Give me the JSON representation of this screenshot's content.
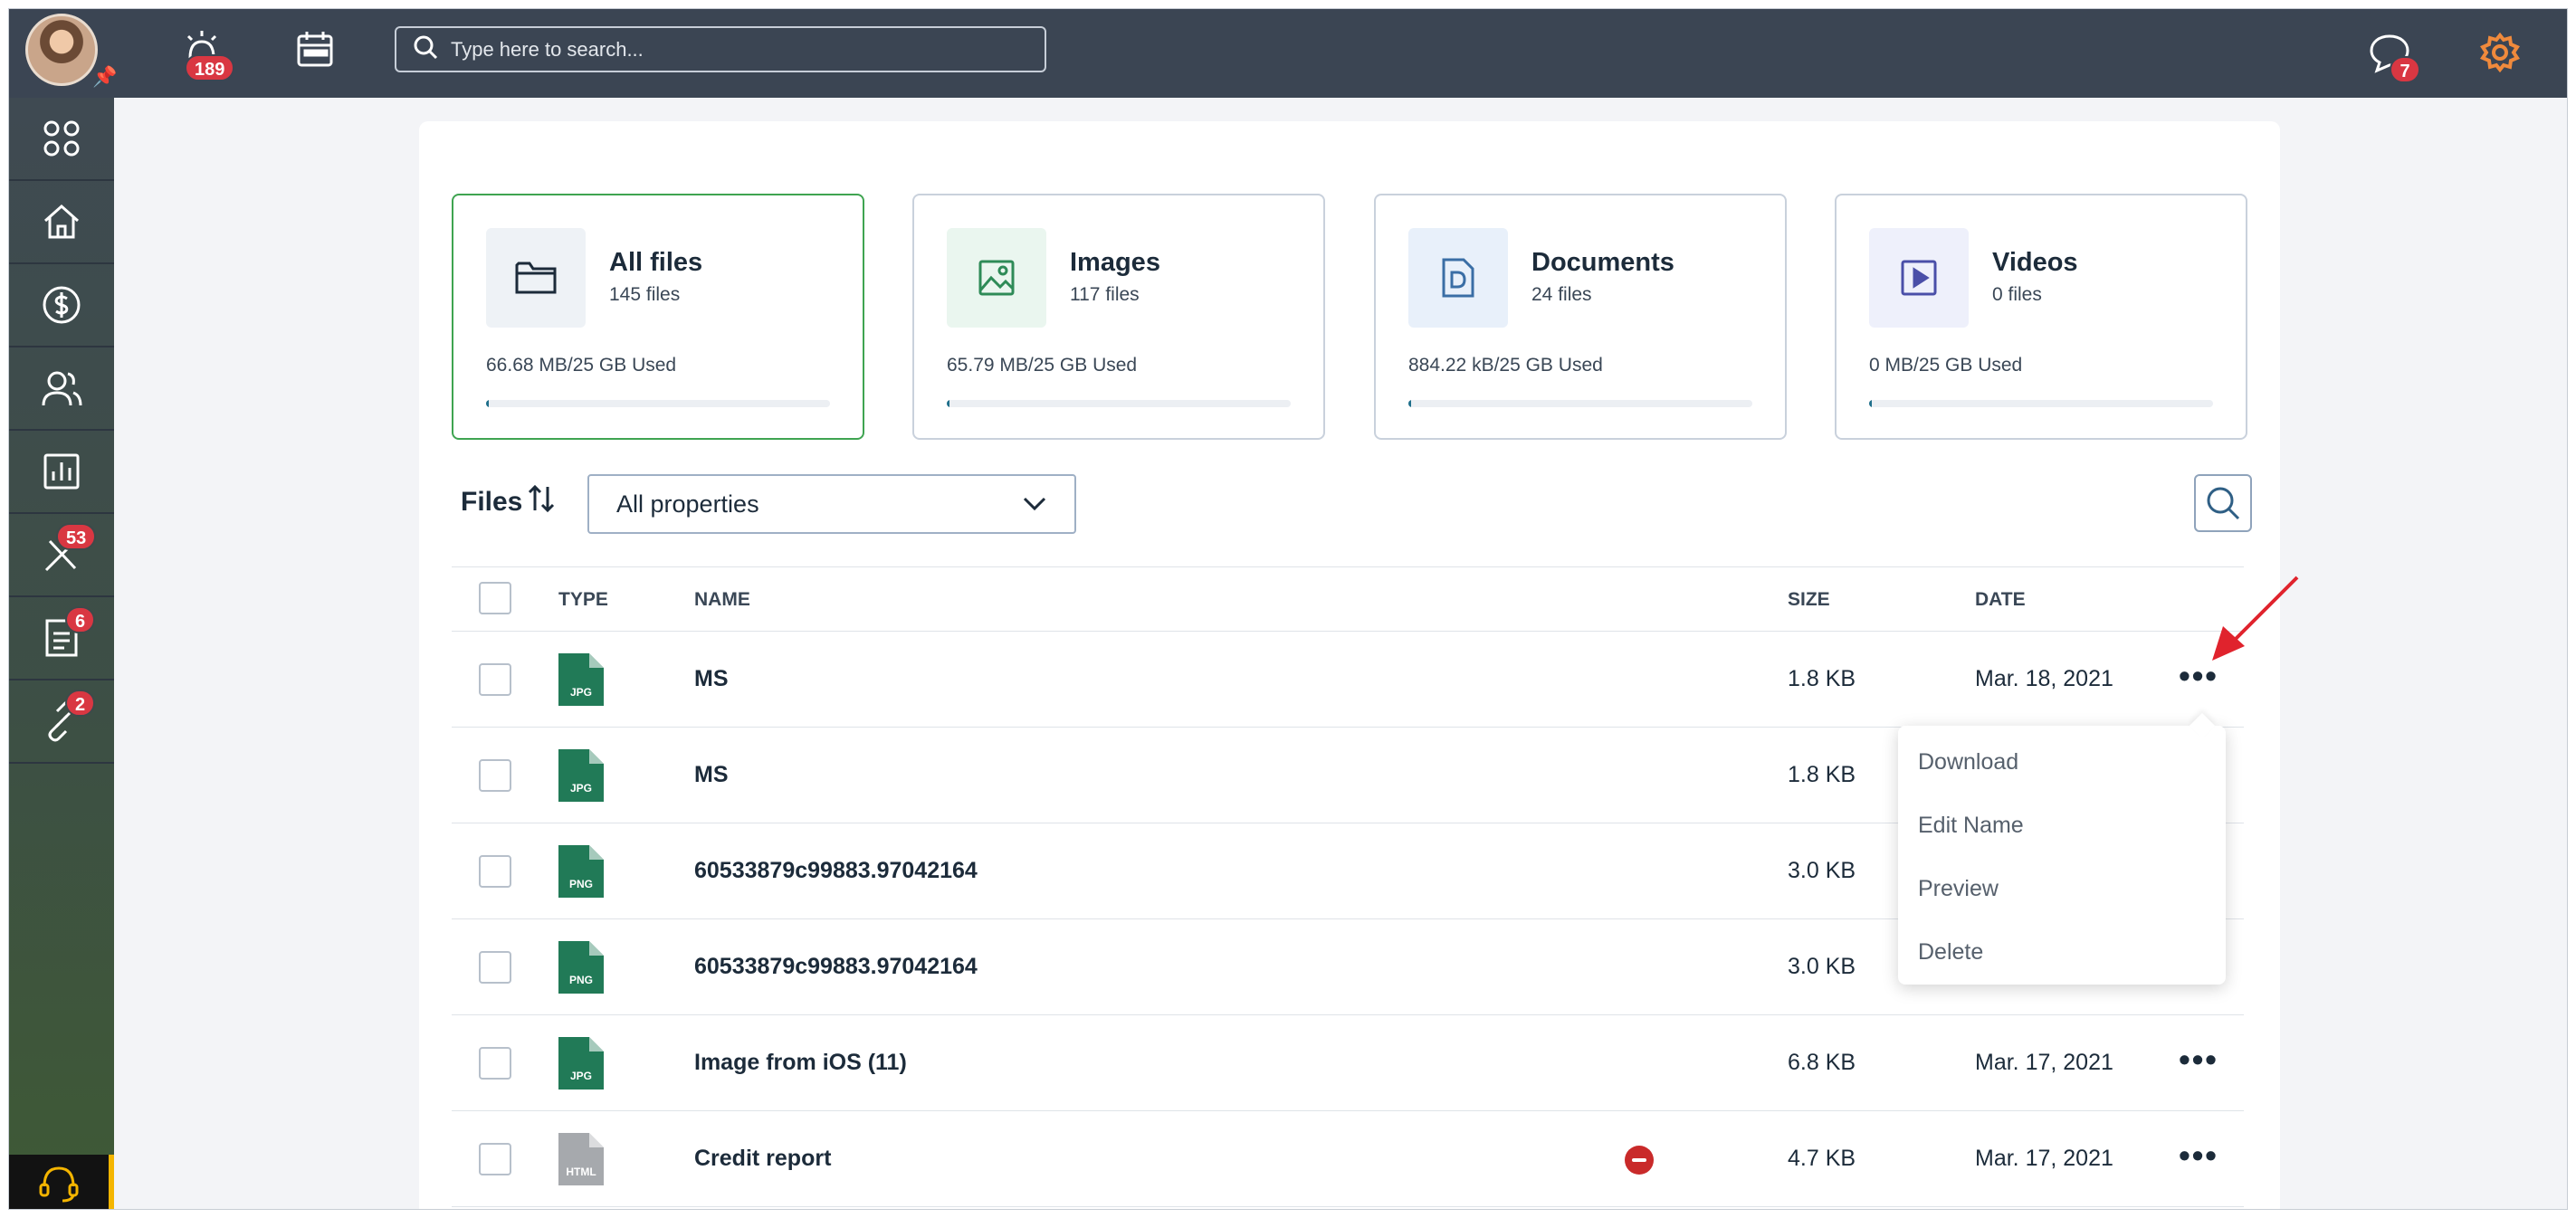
{
  "topbar": {
    "notifications_badge": "189",
    "messages_badge": "7",
    "search_placeholder": "Type here to search..."
  },
  "sidebar": {
    "items": [
      {
        "name": "apps",
        "badge": ""
      },
      {
        "name": "home",
        "badge": ""
      },
      {
        "name": "billing",
        "badge": ""
      },
      {
        "name": "contacts",
        "badge": ""
      },
      {
        "name": "reports",
        "badge": ""
      },
      {
        "name": "tools",
        "badge": "53"
      },
      {
        "name": "documents",
        "badge": "6"
      },
      {
        "name": "links",
        "badge": "2"
      }
    ]
  },
  "stats": [
    {
      "title": "All files",
      "count": "145 files",
      "used": "66.68 MB/25 GB Used",
      "fraction": 0.003,
      "icon": "folder-icon",
      "bg": "#eef2f6",
      "color": "#1c2b3a"
    },
    {
      "title": "Images",
      "count": "117 files",
      "used": "65.79 MB/25 GB Used",
      "fraction": 0.003,
      "icon": "image-icon",
      "bg": "#eaf6ef",
      "color": "#2e8b57"
    },
    {
      "title": "Documents",
      "count": "24 files",
      "used": "884.22 kB/25 GB Used",
      "fraction": 0.0,
      "icon": "document-icon",
      "bg": "#e8f0fa",
      "color": "#3a6ea5"
    },
    {
      "title": "Videos",
      "count": "0 files",
      "used": "0 MB/25 GB Used",
      "fraction": 0.0,
      "icon": "video-icon",
      "bg": "#eef0fb",
      "color": "#4a4fa8"
    }
  ],
  "files_section": {
    "label": "Files",
    "filter_value": "All properties"
  },
  "table": {
    "headers": {
      "type": "TYPE",
      "name": "NAME",
      "size": "SIZE",
      "date": "DATE"
    },
    "rows": [
      {
        "ext": "JPG",
        "name": "MS",
        "size": "1.8 KB",
        "date": "Mar. 18, 2021",
        "color": "#217a57"
      },
      {
        "ext": "JPG",
        "name": "MS",
        "size": "1.8 KB",
        "date": "",
        "color": "#217a57"
      },
      {
        "ext": "PNG",
        "name": "60533879c99883.97042164",
        "size": "3.0 KB",
        "date": "",
        "color": "#217a57"
      },
      {
        "ext": "PNG",
        "name": "60533879c99883.97042164",
        "size": "3.0 KB",
        "date": "",
        "color": "#217a57"
      },
      {
        "ext": "JPG",
        "name": "Image from iOS (11)",
        "size": "6.8 KB",
        "date": "Mar. 17, 2021",
        "color": "#217a57"
      },
      {
        "ext": "HTML",
        "name": "Credit report",
        "size": "4.7 KB",
        "date": "Mar. 17, 2021",
        "color": "#a6a9ad"
      }
    ]
  },
  "context_menu": {
    "items": [
      "Download",
      "Edit Name",
      "Preview",
      "Delete"
    ]
  }
}
